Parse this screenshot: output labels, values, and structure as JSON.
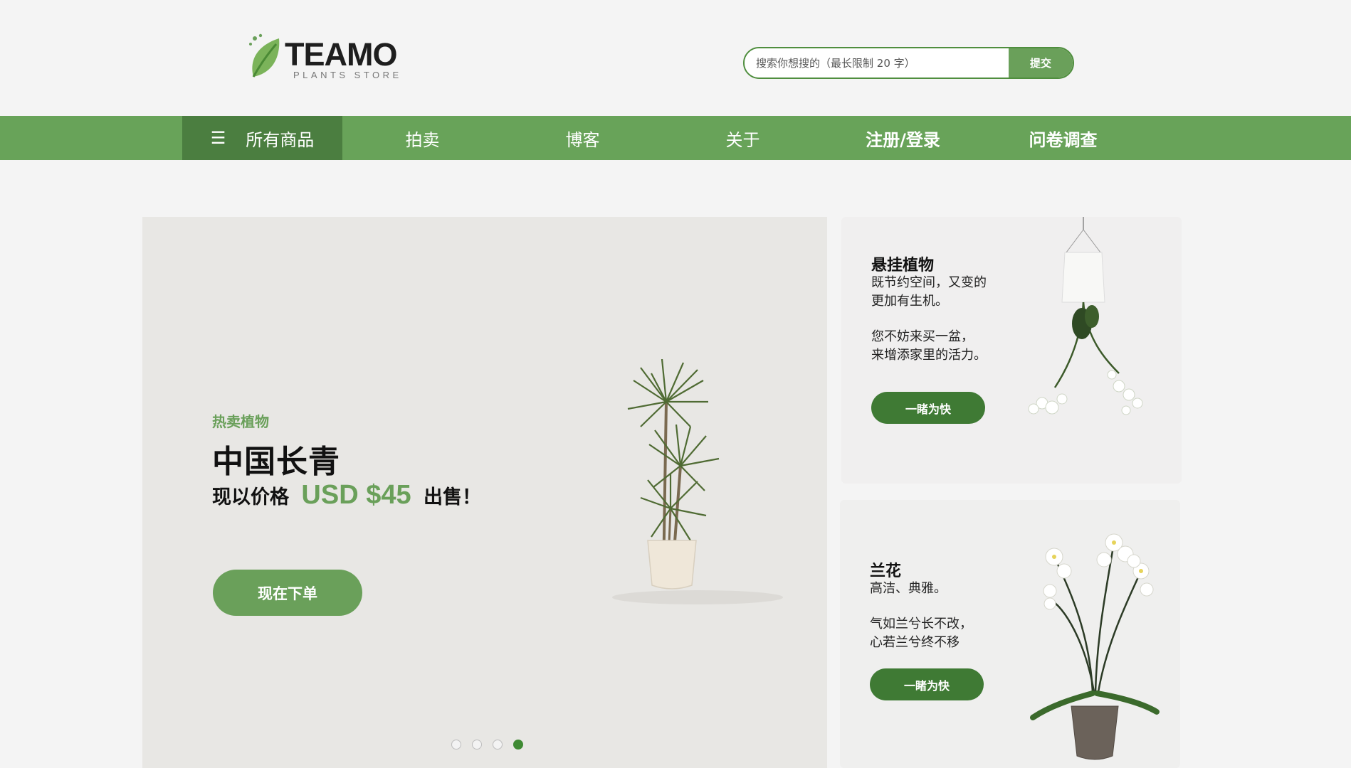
{
  "brand": {
    "name": "TEAMO",
    "tagline": "PLANTS STORE",
    "colors": {
      "primary": "#6aa05a",
      "primary_dark": "#4b7e40",
      "button_dark": "#3f7a34"
    }
  },
  "search": {
    "placeholder": "搜索你想搜的（最长限制 20 字）",
    "value": "",
    "submit_label": "提交"
  },
  "nav": {
    "menu_icon": "☰",
    "items": [
      {
        "label": "所有商品"
      },
      {
        "label": "拍卖"
      },
      {
        "label": "博客"
      },
      {
        "label": "关于"
      },
      {
        "label": "注册/登录"
      },
      {
        "label": "问卷调查"
      }
    ]
  },
  "hero": {
    "eyebrow": "热卖植物",
    "title": "中国长青",
    "price_prefix": "现以价格",
    "price": "USD $45",
    "price_suffix": "出售！",
    "cta_label": "现在下单",
    "carousel": {
      "slides": 4,
      "active_index": 4
    }
  },
  "cards": [
    {
      "title": "悬挂植物",
      "line1": "既节约空间，又变的",
      "line2": "更加有生机。",
      "line3": "您不妨来买一盆，",
      "line4": "来增添家里的活力。",
      "cta_label": "一睹为快",
      "image_icon": "hanging-plant-image"
    },
    {
      "title": "兰花",
      "line1": "高洁、典雅。",
      "line2": "气如兰兮长不改，",
      "line3": "心若兰兮终不移",
      "cta_label": "一睹为快",
      "image_icon": "orchid-image"
    }
  ]
}
